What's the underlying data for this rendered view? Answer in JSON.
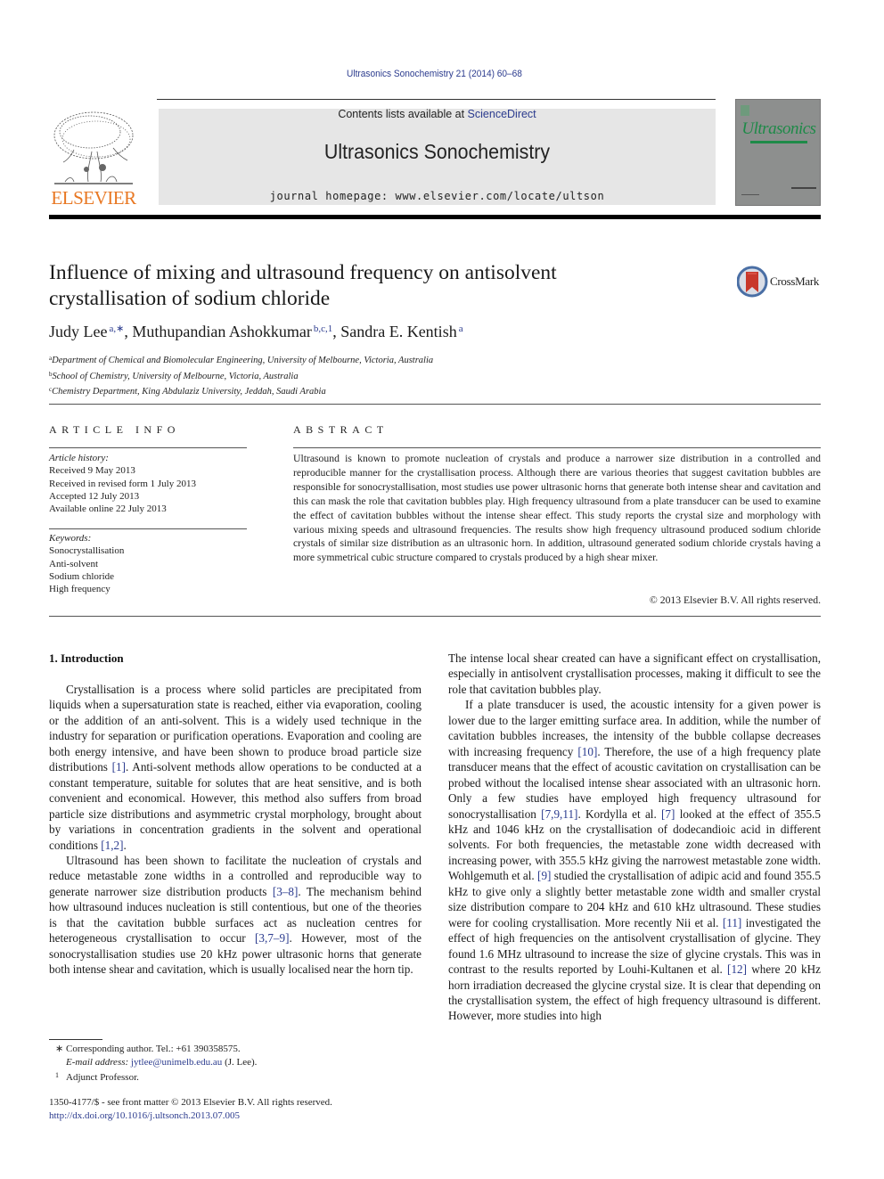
{
  "header": {
    "journal_reference": "Ultrasonics Sonochemistry 21 (2014) 60–68",
    "publisher_logo_text": "ELSEVIER",
    "contents_prefix": "Contents lists available at ",
    "contents_link": "ScienceDirect",
    "journal_name": "Ultrasonics Sonochemistry",
    "homepage_line": "journal homepage: www.elsevier.com/locate/ultson",
    "cover_title": "Ultrasonics",
    "colors": {
      "link_blue": "#2b3b8e",
      "elsevier_orange": "#e87722",
      "cover_gray": "#8d8f8e",
      "cover_green": "#1e8a48"
    }
  },
  "article": {
    "title_line1": "Influence of mixing and ultrasound frequency on antisolvent",
    "title_line2": "crystallisation of sodium chloride",
    "crossmark_label": "CrossMark",
    "authors": [
      {
        "name": "Judy Lee",
        "sup": "a,∗"
      },
      {
        "name": "Muthupandian Ashokkumar",
        "sup": "b,c,1"
      },
      {
        "name": "Sandra E. Kentish",
        "sup": "a"
      }
    ],
    "affiliations": [
      {
        "key": "a",
        "text": "Department of Chemical and Biomolecular Engineering, University of Melbourne, Victoria, Australia"
      },
      {
        "key": "b",
        "text": "School of Chemistry, University of Melbourne, Victoria, Australia"
      },
      {
        "key": "c",
        "text": "Chemistry Department, King Abdulaziz University, Jeddah, Saudi Arabia"
      }
    ]
  },
  "article_info": {
    "heading": "ARTICLE INFO",
    "history_label": "Article history:",
    "history": [
      "Received 9 May 2013",
      "Received in revised form 1 July 2013",
      "Accepted 12 July 2013",
      "Available online 22 July 2013"
    ],
    "keywords_label": "Keywords:",
    "keywords": [
      "Sonocrystallisation",
      "Anti-solvent",
      "Sodium chloride",
      "High frequency"
    ]
  },
  "abstract": {
    "heading": "ABSTRACT",
    "text": "Ultrasound is known to promote nucleation of crystals and produce a narrower size distribution in a controlled and reproducible manner for the crystallisation process. Although there are various theories that suggest cavitation bubbles are responsible for sonocrystallisation, most studies use power ultrasonic horns that generate both intense shear and cavitation and this can mask the role that cavitation bubbles play. High frequency ultrasound from a plate transducer can be used to examine the effect of cavitation bubbles without the intense shear effect. This study reports the crystal size and morphology with various mixing speeds and ultrasound frequencies. The results show high frequency ultrasound produced sodium chloride crystals of similar size distribution as an ultrasonic horn. In addition, ultrasound generated sodium chloride crystals having a more symmetrical cubic structure compared to crystals produced by a high shear mixer.",
    "copyright": "© 2013 Elsevier B.V. All rights reserved."
  },
  "body": {
    "section_heading": "1. Introduction",
    "left_paragraphs": [
      {
        "parts": [
          {
            "t": "Crystallisation is a process where solid particles are precipitated from liquids when a supersaturation state is reached, either via evaporation, cooling or the addition of an anti-solvent. This is a widely used technique in the industry for separation or purification operations. Evaporation and cooling are both energy intensive, and have been shown to produce broad particle size distributions "
          },
          {
            "ref": "[1]"
          },
          {
            "t": ". Anti-solvent methods allow operations to be conducted at a constant temperature, suitable for solutes that are heat sensitive, and is both convenient and economical. However, this method also suffers from broad particle size distributions and asymmetric crystal morphology, brought about by variations in concentration gradients in the solvent and operational conditions "
          },
          {
            "ref": "[1,2]"
          },
          {
            "t": "."
          }
        ]
      },
      {
        "parts": [
          {
            "t": "Ultrasound has been shown to facilitate the nucleation of crystals and reduce metastable zone widths in a controlled and reproducible way to generate narrower size distribution products "
          },
          {
            "ref": "[3–8]"
          },
          {
            "t": ". The mechanism behind how ultrasound induces nucleation is still contentious, but one of the theories is that the cavitation bubble surfaces act as nucleation centres for heterogeneous crystallisation to occur "
          },
          {
            "ref": "[3,7–9]"
          },
          {
            "t": ". However, most of the sonocrystallisation studies use 20 kHz power ultrasonic horns that generate both intense shear and cavitation, which is usually localised near the horn tip."
          }
        ]
      }
    ],
    "right_paragraphs": [
      {
        "noindent": true,
        "parts": [
          {
            "t": "The intense local shear created can have a significant effect on crystallisation, especially in antisolvent crystallisation processes, making it difficult to see the role that cavitation bubbles play."
          }
        ]
      },
      {
        "parts": [
          {
            "t": "If a plate transducer is used, the acoustic intensity for a given power is lower due to the larger emitting surface area. In addition, while the number of cavitation bubbles increases, the intensity of the bubble collapse decreases with increasing frequency "
          },
          {
            "ref": "[10]"
          },
          {
            "t": ". Therefore, the use of a high frequency plate transducer means that the effect of acoustic cavitation on crystallisation can be probed without the localised intense shear associated with an ultrasonic horn. Only a few studies have employed high frequency ultrasound for sonocrystallisation "
          },
          {
            "ref": "[7,9,11]"
          },
          {
            "t": ". Kordylla et al. "
          },
          {
            "ref": "[7]"
          },
          {
            "t": " looked at the effect of 355.5 kHz and 1046 kHz on the crystallisation of dodecandioic acid in different solvents. For both frequencies, the metastable zone width decreased with increasing power, with 355.5 kHz giving the narrowest metastable zone width. Wohlgemuth et al. "
          },
          {
            "ref": "[9]"
          },
          {
            "t": " studied the crystallisation of adipic acid and found 355.5 kHz to give only a slightly better metastable zone width and smaller crystal size distribution compare to 204 kHz and 610 kHz ultrasound. These studies were for cooling crystallisation. More recently Nii et al. "
          },
          {
            "ref": "[11]"
          },
          {
            "t": " investigated the effect of high frequencies on the antisolvent crystallisation of glycine. They found 1.6 MHz ultrasound to increase the size of glycine crystals. This was in contrast to the results reported by Louhi-Kultanen et al. "
          },
          {
            "ref": "[12]"
          },
          {
            "t": " where 20 kHz horn irradiation decreased the glycine crystal size. It is clear that depending on the crystallisation system, the effect of high frequency ultrasound is different. However, more studies into high"
          }
        ]
      }
    ]
  },
  "footnotes": {
    "corresponding_mark": "∗",
    "corresponding_text": "Corresponding author. Tel.: +61 390358575.",
    "email_label": "E-mail address:",
    "email": "jytlee@unimelb.edu.au",
    "email_suffix": " (J. Lee).",
    "adjunct_mark": "1",
    "adjunct_text": "Adjunct Professor."
  },
  "front_matter": {
    "issn_line": "1350-4177/$ - see front matter © 2013 Elsevier B.V. All rights reserved.",
    "doi": "http://dx.doi.org/10.1016/j.ultsonch.2013.07.005"
  }
}
